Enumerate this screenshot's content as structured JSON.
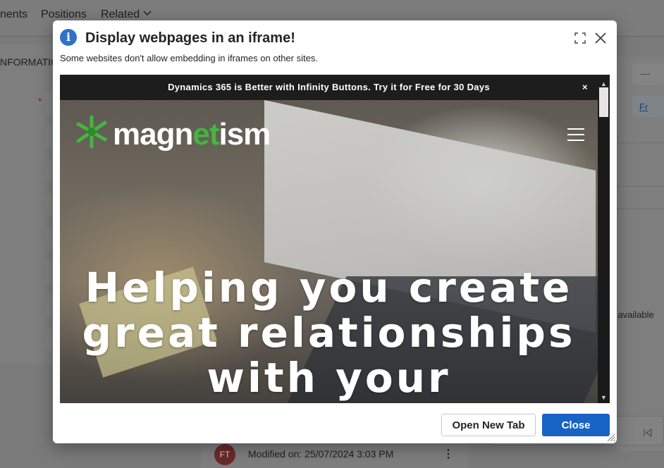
{
  "background": {
    "tabs": [
      "nents",
      "Positions",
      "Related"
    ],
    "section_label": "NFORMATIO",
    "required_marker": "*",
    "dash_value": "---",
    "follow_label": "Fr",
    "no_data_text": "ta available",
    "activity": {
      "avatar_initials": "FT",
      "modified_text": "Modified on: 25/07/2024 3:03 PM"
    }
  },
  "dialog": {
    "title": "Display webpages in an iframe!",
    "subtitle": "Some websites don't allow embedding in iframes on other sites.",
    "icons": {
      "info": "info-icon",
      "expand": "expand-icon",
      "close": "close-icon"
    },
    "iframe": {
      "promo_text": "Dynamics 365 is Better with Infinity Buttons.  Try it for Free for 30 Days",
      "promo_close": "×",
      "logo_text_before": "magn",
      "logo_text_accent": "et",
      "logo_text_after": "ism",
      "headline_lines": [
        "Helping you create",
        "great relationships",
        "with your"
      ],
      "colors": {
        "logo_accent": "#45b53f",
        "promo_bg": "#1d1d1d"
      }
    },
    "buttons": {
      "open_new_tab": "Open New Tab",
      "close": "Close"
    },
    "colors": {
      "primary": "#1764c5",
      "info_icon": "#3172c6"
    }
  }
}
